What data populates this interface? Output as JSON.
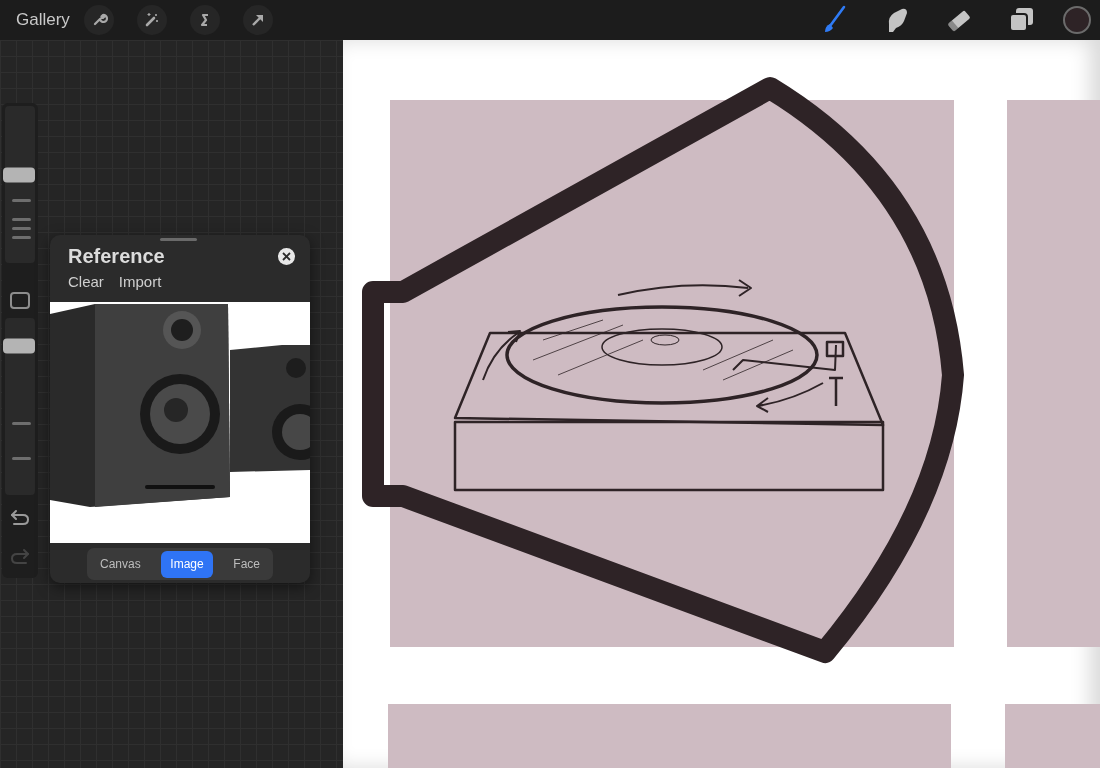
{
  "top_bar": {
    "gallery": "Gallery",
    "tools": [
      {
        "kind": "brush",
        "selected": true
      },
      {
        "kind": "smudge",
        "selected": false
      },
      {
        "kind": "eraser",
        "selected": false
      },
      {
        "kind": "layers",
        "selected": false
      }
    ],
    "color_swatch": {
      "color": "#2e2326"
    }
  },
  "sidebar": {
    "size_slider": {
      "level": 0.56
    },
    "opacity_slider": {
      "level": 0.84
    },
    "undo": {
      "disabled": false
    },
    "redo": {
      "disabled": true
    }
  },
  "reference": {
    "title": "Reference",
    "actions": [
      "Clear",
      "Import"
    ],
    "image": {
      "kind": "picture"
    },
    "tabs": [
      {
        "label": "Canvas",
        "selected": false
      },
      {
        "label": "Image",
        "selected": true
      },
      {
        "label": "Face",
        "selected": false
      }
    ]
  }
}
